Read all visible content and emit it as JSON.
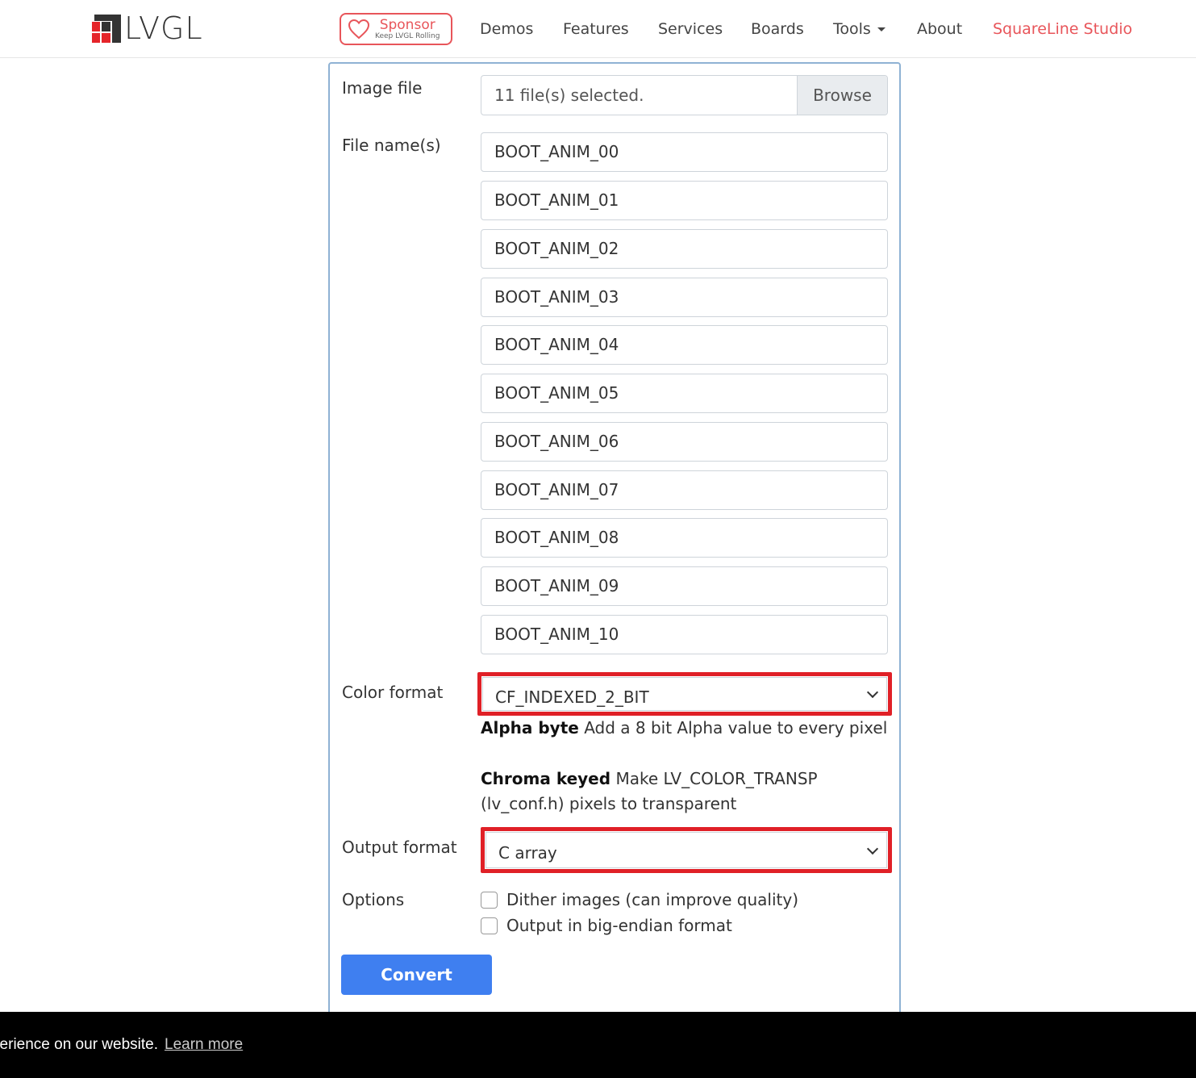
{
  "brand": {
    "name": "LVGL"
  },
  "nav": {
    "sponsor_label": "Sponsor",
    "sponsor_sub": "Keep LVGL Rolling",
    "items": [
      "Demos",
      "Features",
      "Services",
      "Boards",
      "Tools",
      "About"
    ],
    "cta": "SquareLine Studio"
  },
  "form": {
    "image_file_label": "Image file",
    "file_selected_text": "11 file(s) selected.",
    "browse_label": "Browse",
    "file_names_label": "File name(s)",
    "file_names": [
      "BOOT_ANIM_00",
      "BOOT_ANIM_01",
      "BOOT_ANIM_02",
      "BOOT_ANIM_03",
      "BOOT_ANIM_04",
      "BOOT_ANIM_05",
      "BOOT_ANIM_06",
      "BOOT_ANIM_07",
      "BOOT_ANIM_08",
      "BOOT_ANIM_09",
      "BOOT_ANIM_10"
    ],
    "color_format_label": "Color format",
    "color_format_value": "CF_INDEXED_2_BIT",
    "help": {
      "alpha_title": "Alpha byte",
      "alpha_text": "Add a 8 bit Alpha value to every pixel",
      "chroma_title": "Chroma keyed",
      "chroma_text": "Make LV_COLOR_TRANSP (lv_conf.h) pixels to transparent"
    },
    "output_format_label": "Output format",
    "output_format_value": "C array",
    "options_label": "Options",
    "options": [
      {
        "label": "Dither images (can improve quality)",
        "checked": false
      },
      {
        "label": "Output in big-endian format",
        "checked": false
      }
    ],
    "convert_label": "Convert"
  },
  "cookie": {
    "message": "erience on our website.",
    "learn_more": "Learn more"
  },
  "colors": {
    "accent_red": "#e8555a",
    "highlight_red": "#e02027",
    "button_blue": "#3f7ff0",
    "card_border": "#8fb2d4"
  }
}
